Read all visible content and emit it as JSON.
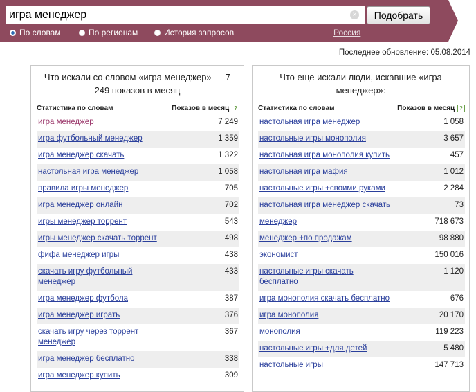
{
  "search": {
    "value": "игра менеджер",
    "submit_label": "Подобрать",
    "clear_glyph": "×"
  },
  "modes": [
    {
      "label": "По словам",
      "checked": true
    },
    {
      "label": "По регионам",
      "checked": false
    },
    {
      "label": "История запросов",
      "checked": false
    }
  ],
  "region": "Россия",
  "last_update": "Последнее обновление: 05.08.2014",
  "left_panel": {
    "title": "Что искали со словом «игра менеджер» — 7 249 показов в месяц",
    "col_query": "Статистика по словам",
    "col_count": "Показов в месяц",
    "help_glyph": "?",
    "rows": [
      {
        "q": "игра менеджер",
        "n": "7 249"
      },
      {
        "q": "игра футбольный менеджер",
        "n": "1 359"
      },
      {
        "q": "игра менеджер скачать",
        "n": "1 322"
      },
      {
        "q": "настольная игра менеджер",
        "n": "1 058"
      },
      {
        "q": "правила игры менеджер",
        "n": "705"
      },
      {
        "q": "игра менеджер онлайн",
        "n": "702"
      },
      {
        "q": "игры менеджер торрент",
        "n": "543"
      },
      {
        "q": "игры менеджер скачать торрент",
        "n": "498"
      },
      {
        "q": "фифа менеджер игры",
        "n": "438"
      },
      {
        "q": "скачать игру футбольный менеджер",
        "n": "433"
      },
      {
        "q": "игра менеджер футбола",
        "n": "387"
      },
      {
        "q": "игра менеджер играть",
        "n": "376"
      },
      {
        "q": "скачать игру через торрент менеджер",
        "n": "367"
      },
      {
        "q": "игра менеджер бесплатно",
        "n": "338"
      },
      {
        "q": "игра менеджер купить",
        "n": "309"
      }
    ]
  },
  "right_panel": {
    "title": "Что еще искали люди, искавшие «игра менеджер»:",
    "col_query": "Статистика по словам",
    "col_count": "Показов в месяц",
    "help_glyph": "?",
    "rows": [
      {
        "q": "настольная игра менеджер",
        "n": "1 058"
      },
      {
        "q": "настольные игры монополия",
        "n": "3 657"
      },
      {
        "q": "настольная игра монополия купить",
        "n": "457"
      },
      {
        "q": "настольная игра мафия",
        "n": "1 012"
      },
      {
        "q": "настольные игры +своими руками",
        "n": "2 284"
      },
      {
        "q": "настольная игра менеджер скачать",
        "n": "73"
      },
      {
        "q": "менеджер",
        "n": "718 673"
      },
      {
        "q": "менеджер +по продажам",
        "n": "98 880"
      },
      {
        "q": "экономист",
        "n": "150 016"
      },
      {
        "q": "настольные игры скачать бесплатно",
        "n": "1 120"
      },
      {
        "q": "игра монополия скачать бесплатно",
        "n": "676"
      },
      {
        "q": "игра монополия",
        "n": "20 170"
      },
      {
        "q": "монополия",
        "n": "119 223"
      },
      {
        "q": "настольные игры +для детей",
        "n": "5 480"
      },
      {
        "q": "настольные игры",
        "n": "147 713"
      }
    ]
  },
  "colors": {
    "header_bg": "#8e4a5e",
    "link": "#2a3f9c",
    "visited_link": "#9c3a6d",
    "row_alt_bg": "#eeeeee"
  }
}
